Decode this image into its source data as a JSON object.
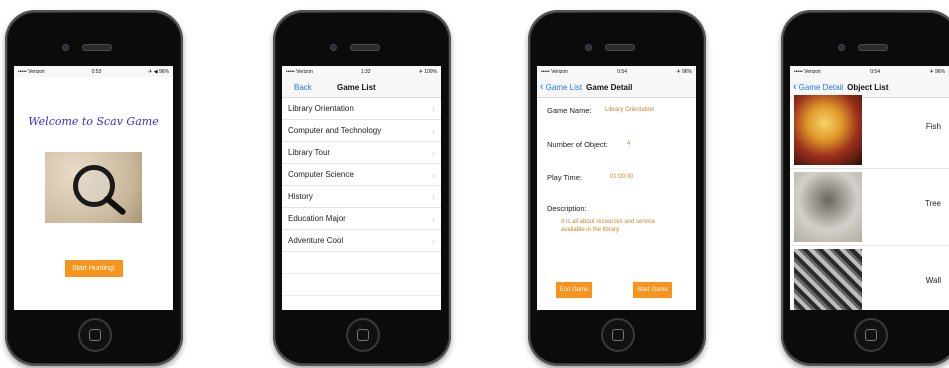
{
  "phone1": {
    "status": {
      "carrier": "••••• Verizon",
      "time": "0:53",
      "battery": "✈ ◀ 96%"
    },
    "welcome_text": "Welcome to Scav Game",
    "start_button": "Start Hunting!"
  },
  "phone2": {
    "status": {
      "carrier": "••••• Verizon",
      "time": "1:32",
      "battery": "✈ 100%"
    },
    "nav": {
      "back": "Back",
      "title": "Game List"
    },
    "games": [
      "Library Orientation",
      "Computer and Technology",
      "Library Tour",
      "Computer Science",
      "History",
      "Education Major",
      "Adventure Cool"
    ]
  },
  "phone3": {
    "status": {
      "carrier": "••••• Verizon",
      "time": "0:54",
      "battery": "✈ 96%"
    },
    "nav": {
      "back": "Game List",
      "title": "Game Detail"
    },
    "game_name_label": "Game Name:",
    "game_name": "Library Orientation",
    "num_objects_label": "Number of Object:",
    "num_objects": "4",
    "play_time_label": "Play Time:",
    "play_time": "01:00:00",
    "description_label": "Description:",
    "description": "It is all about resources and service available in the library",
    "end_button": "End Game",
    "start_button": "Start Game"
  },
  "phone4": {
    "status": {
      "carrier": "••••• Verizon",
      "time": "0:54",
      "battery": "✈ 96%"
    },
    "nav": {
      "back": "Game Detail",
      "title": "Object List"
    },
    "objects": [
      "Fish",
      "Tree",
      "Wall"
    ]
  },
  "colors": {
    "ios_blue": "#1e7cf5",
    "orange": "#f7941d",
    "welcome_purple": "#3b2bd1",
    "detail_value": "#c7882a"
  }
}
